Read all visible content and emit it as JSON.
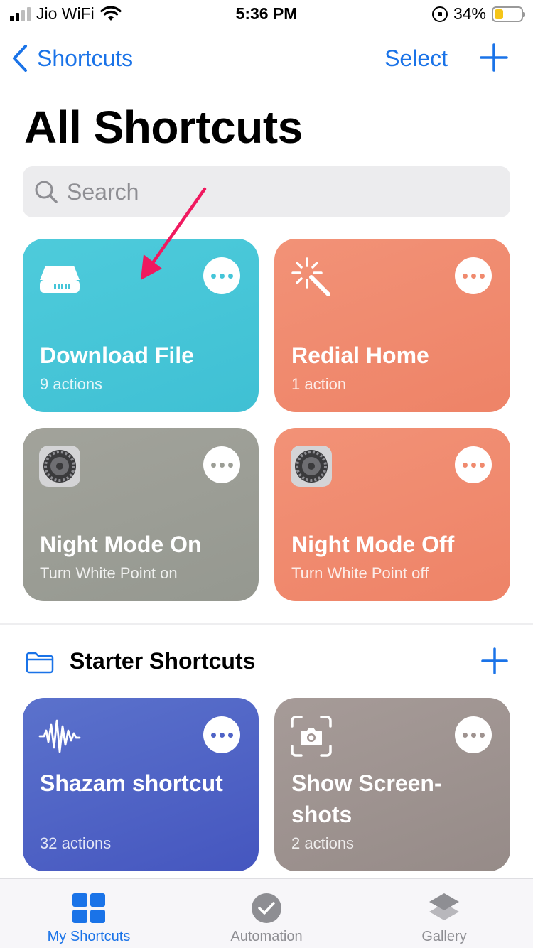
{
  "status_bar": {
    "carrier": "Jio WiFi",
    "time": "5:36 PM",
    "battery": "34%",
    "battery_level": 0.34
  },
  "nav": {
    "back_label": "Shortcuts",
    "select_label": "Select"
  },
  "page_title": "All Shortcuts",
  "search": {
    "placeholder": "Search"
  },
  "shortcuts": [
    {
      "title": "Download File",
      "subtitle": "9 actions",
      "icon": "drive-icon",
      "color": "#45c5d8",
      "dot_color": "#45c5d8"
    },
    {
      "title": "Redial Home",
      "subtitle": "1 action",
      "icon": "magic-wand-icon",
      "color": "#f08a6e",
      "dot_color": "#f08a6e"
    },
    {
      "title": "Night Mode On",
      "subtitle": "Turn White Point on",
      "icon": "settings-gear-icon",
      "color": "#9c9e96",
      "dot_color": "#9c9e96"
    },
    {
      "title": "Night Mode Off",
      "subtitle": "Turn White Point off",
      "icon": "settings-gear-icon",
      "color": "#f08a6e",
      "dot_color": "#f08a6e"
    }
  ],
  "starter_section": {
    "title": "Starter Shortcuts",
    "items": [
      {
        "title": "Shazam shortcut",
        "subtitle": "32 actions",
        "icon": "waveform-icon",
        "color": "#4f63c6",
        "dot_color": "#4f63c6"
      },
      {
        "title": "Show Screen-shots",
        "subtitle": "2 actions",
        "icon": "screenshot-camera-icon",
        "color": "#9f9390",
        "dot_color": "#9f9390"
      }
    ]
  },
  "tabs": [
    {
      "label": "My Shortcuts",
      "icon": "grid-icon",
      "active": true
    },
    {
      "label": "Automation",
      "icon": "checkmark-clock-icon",
      "active": false
    },
    {
      "label": "Gallery",
      "icon": "layers-icon",
      "active": false
    }
  ],
  "accent_color": "#1a73e8",
  "annotation": {
    "arrow_color": "#f0195f"
  }
}
